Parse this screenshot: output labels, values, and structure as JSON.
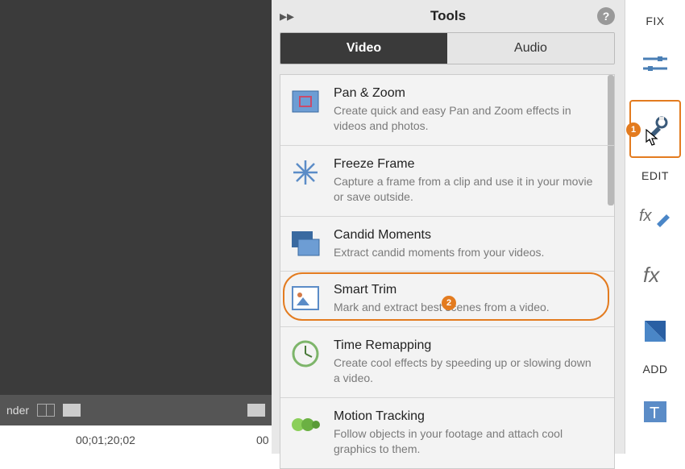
{
  "panel": {
    "title": "Tools",
    "tabs": {
      "video": "Video",
      "audio": "Audio"
    }
  },
  "tools": {
    "pan_zoom": {
      "title": "Pan & Zoom",
      "desc": "Create quick and easy Pan and Zoom effects in videos and photos."
    },
    "freeze": {
      "title": "Freeze Frame",
      "desc": "Capture a frame from a clip and use it in your movie or save outside."
    },
    "candid": {
      "title": "Candid Moments",
      "desc": "Extract candid moments from your videos."
    },
    "smart_trim": {
      "title": "Smart Trim",
      "desc": "Mark and extract best scenes from a video."
    },
    "time_remap": {
      "title": "Time Remapping",
      "desc": "Create cool effects by speeding up or slowing down a video."
    },
    "motion": {
      "title": "Motion Tracking",
      "desc": "Follow objects in your footage and attach cool graphics to them."
    }
  },
  "sidebar": {
    "fix": "FIX",
    "edit": "EDIT",
    "add": "ADD"
  },
  "playbar": {
    "render": "nder"
  },
  "timeline": {
    "t1": "00;01;20;02",
    "t2": "00"
  },
  "callouts": {
    "b1": "1",
    "b2": "2"
  }
}
